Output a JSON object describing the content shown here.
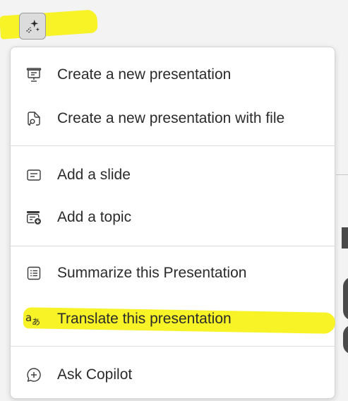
{
  "toolbar": {
    "copilot_button_icon": "copilot-sparkle-icon"
  },
  "menu": {
    "items": [
      {
        "label": "Create a new presentation",
        "icon": "presentation-board-icon"
      },
      {
        "label": "Create a new presentation with file",
        "icon": "file-search-icon"
      },
      {
        "label": "Add a slide",
        "icon": "slide-icon"
      },
      {
        "label": "Add a topic",
        "icon": "add-topic-icon"
      },
      {
        "label": "Summarize this Presentation",
        "icon": "list-summary-icon"
      },
      {
        "label": "Translate this presentation",
        "icon": "translate-icon"
      },
      {
        "label": "Ask Copilot",
        "icon": "chat-add-icon"
      }
    ]
  },
  "colors": {
    "highlight": "#f7f21a",
    "menu_background": "#ffffff",
    "text": "#2b2b2b"
  }
}
